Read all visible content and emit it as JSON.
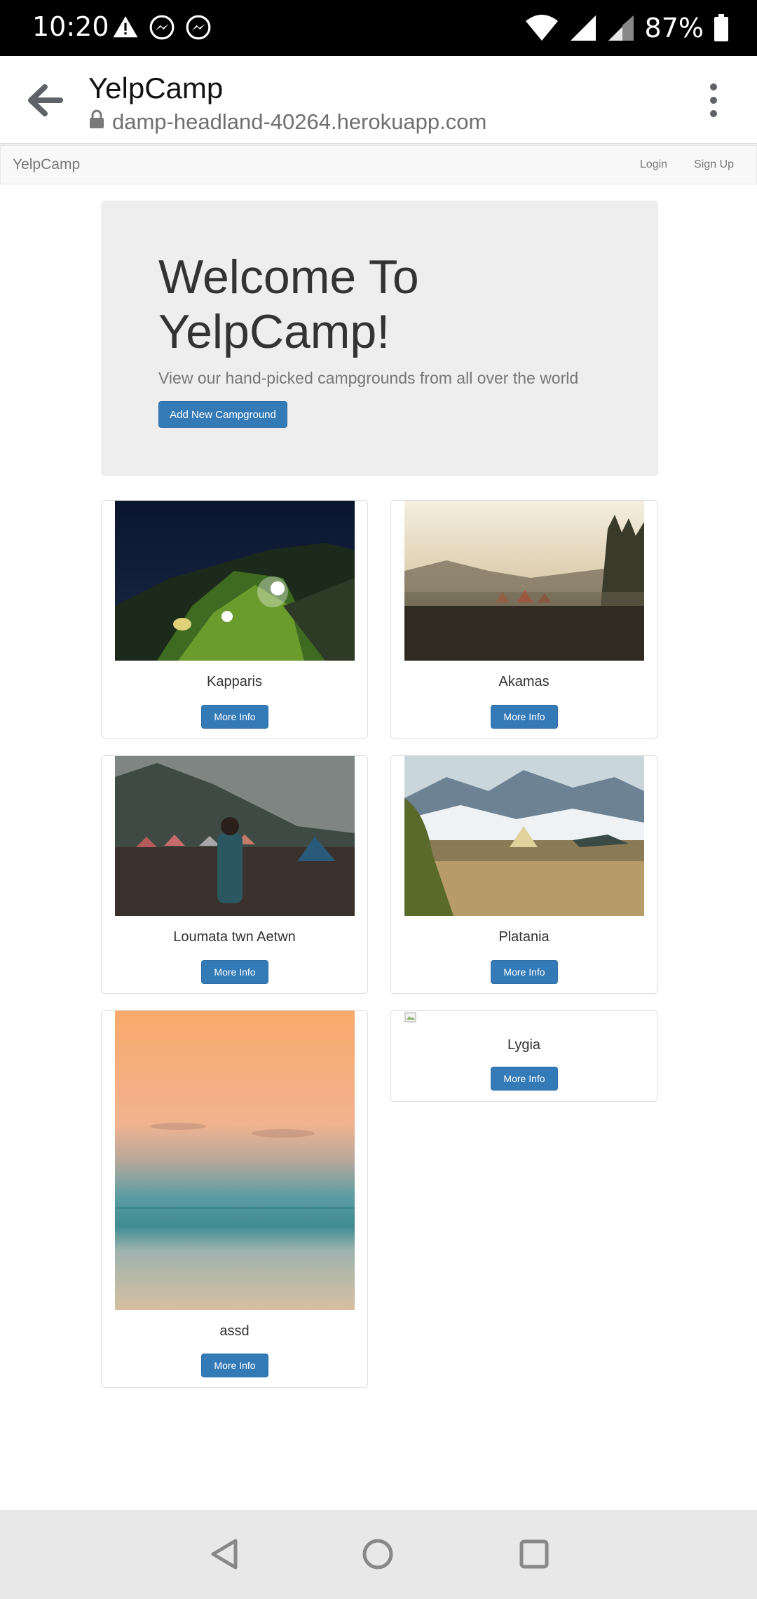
{
  "status_bar": {
    "time": "10:20",
    "battery": "87%"
  },
  "browser": {
    "title": "YelpCamp",
    "url": "damp-headland-40264.herokuapp.com"
  },
  "navbar": {
    "brand": "YelpCamp",
    "login": "Login",
    "signup": "Sign Up"
  },
  "jumbotron": {
    "title": "Welcome To YelpCamp!",
    "subtitle": "View our hand-picked campgrounds from all over the world",
    "button": "Add New Campground"
  },
  "campgrounds": [
    {
      "name": "Kapparis",
      "button": "More Info"
    },
    {
      "name": "Akamas",
      "button": "More Info"
    },
    {
      "name": "Loumata twn Aetwn",
      "button": "More Info"
    },
    {
      "name": "Platania",
      "button": "More Info"
    },
    {
      "name": "assd",
      "button": "More Info"
    },
    {
      "name": "Lygia",
      "button": "More Info"
    }
  ],
  "colors": {
    "primary": "#337ab7",
    "navbar_bg": "#f8f8f8",
    "jumbotron_bg": "#eeeeee"
  }
}
